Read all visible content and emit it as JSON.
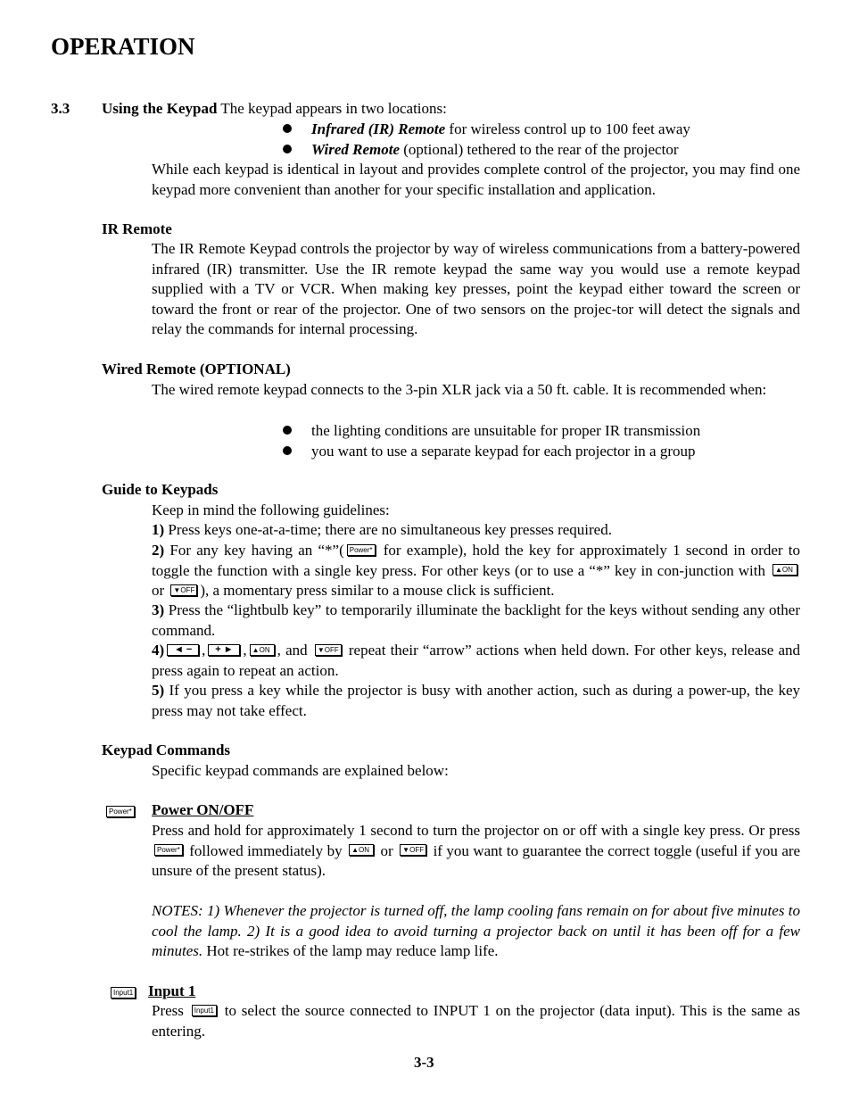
{
  "page_title": "OPERATION",
  "section": {
    "number": "3.3",
    "heading": "Using the Keypad",
    "intro": " The keypad appears in two locations:",
    "bullets": [
      {
        "bold": "Infrared (IR) Remote",
        "text": " for wireless control up to 100 feet away"
      },
      {
        "bold": "Wired Remote",
        "text": " (optional) tethered to the rear of the projector"
      }
    ],
    "para": "While each keypad is identical in layout and provides complete control of the projector, you may find one keypad more convenient than another for your specific installation and application."
  },
  "ir_remote": {
    "heading": "IR Remote",
    "para": "The IR Remote Keypad controls the projector by way of wireless communications from a battery-powered infrared (IR) transmitter. Use the IR remote keypad the same way you would use a remote keypad supplied with a TV or VCR. When making key presses, point the keypad either toward the screen or toward the front or rear of the projector. One of two sensors on the projec-tor will detect the signals and relay the commands for internal processing."
  },
  "wired_remote": {
    "heading": "Wired Remote (OPTIONAL)",
    "para": "The wired remote keypad connects to the 3-pin XLR jack via a 50 ft. cable. It is recommended when:",
    "bullets": [
      "the lighting conditions are unsuitable for proper IR transmission",
      "you want to use a separate keypad for each projector in a group"
    ]
  },
  "guide": {
    "heading": "Guide to Keypads",
    "intro": "Keep in mind the following guidelines:",
    "g1_num": "1)",
    "g1": " Press keys one-at-a-time; there are no simultaneous key presses required.",
    "g2_num": "2)",
    "g2a": " For any key having an “*”(",
    "g2b": " for example), hold the key for approximately 1 second in order to toggle the function with a single key press. For other keys (or to use a “*” key in con-junction with",
    "g2c": "or",
    "g2d": "), a momentary press similar to a mouse click is sufficient.",
    "g3_num": "3)",
    "g3": " Press the “lightbulb key” to temporarily illuminate the backlight for the keys without sending any other command.",
    "g4_num": "4)",
    "g4_sep1": ",",
    "g4_sep2": ",",
    "g4_and": ", and",
    "g4": " repeat their “arrow” actions when held down. For other keys, release and press again to repeat an action.",
    "g5_num": "5)",
    "g5": " If you press a key while the projector is busy with another action, such as during a power-up, the key press may not take effect."
  },
  "keys": {
    "power": "Power*",
    "on": "▲ON",
    "off": "▼OFF",
    "left_minus": "◄ −",
    "plus_right": "+ ►",
    "input1": "Input1"
  },
  "commands": {
    "heading": "Keypad Commands",
    "intro": "Specific keypad commands are explained below:",
    "power": {
      "heading": "Power ON/OFF",
      "line1": "Press and hold for approximately 1 second to turn the projector on or off with a single key press.",
      "line2a": "Or press",
      "line2b": "followed immediately by",
      "line2c": "or",
      "line2d": "if you want to guarantee the correct toggle (useful if you are unsure of the present status).",
      "notes_italic": "NOTES: 1) Whenever the projector is turned off, the lamp cooling fans remain on for about five minutes to cool the lamp. 2) It is a good idea to avoid turning a projector back on until it has been off for a few minutes.",
      "notes_plain": " Hot re-strikes of the lamp may reduce lamp life."
    },
    "input1": {
      "heading": "Input 1",
      "a": "Press",
      "b": " to select the source connected to INPUT 1 on the projector (data input). This is the same as entering."
    }
  },
  "page_number": "3-3"
}
